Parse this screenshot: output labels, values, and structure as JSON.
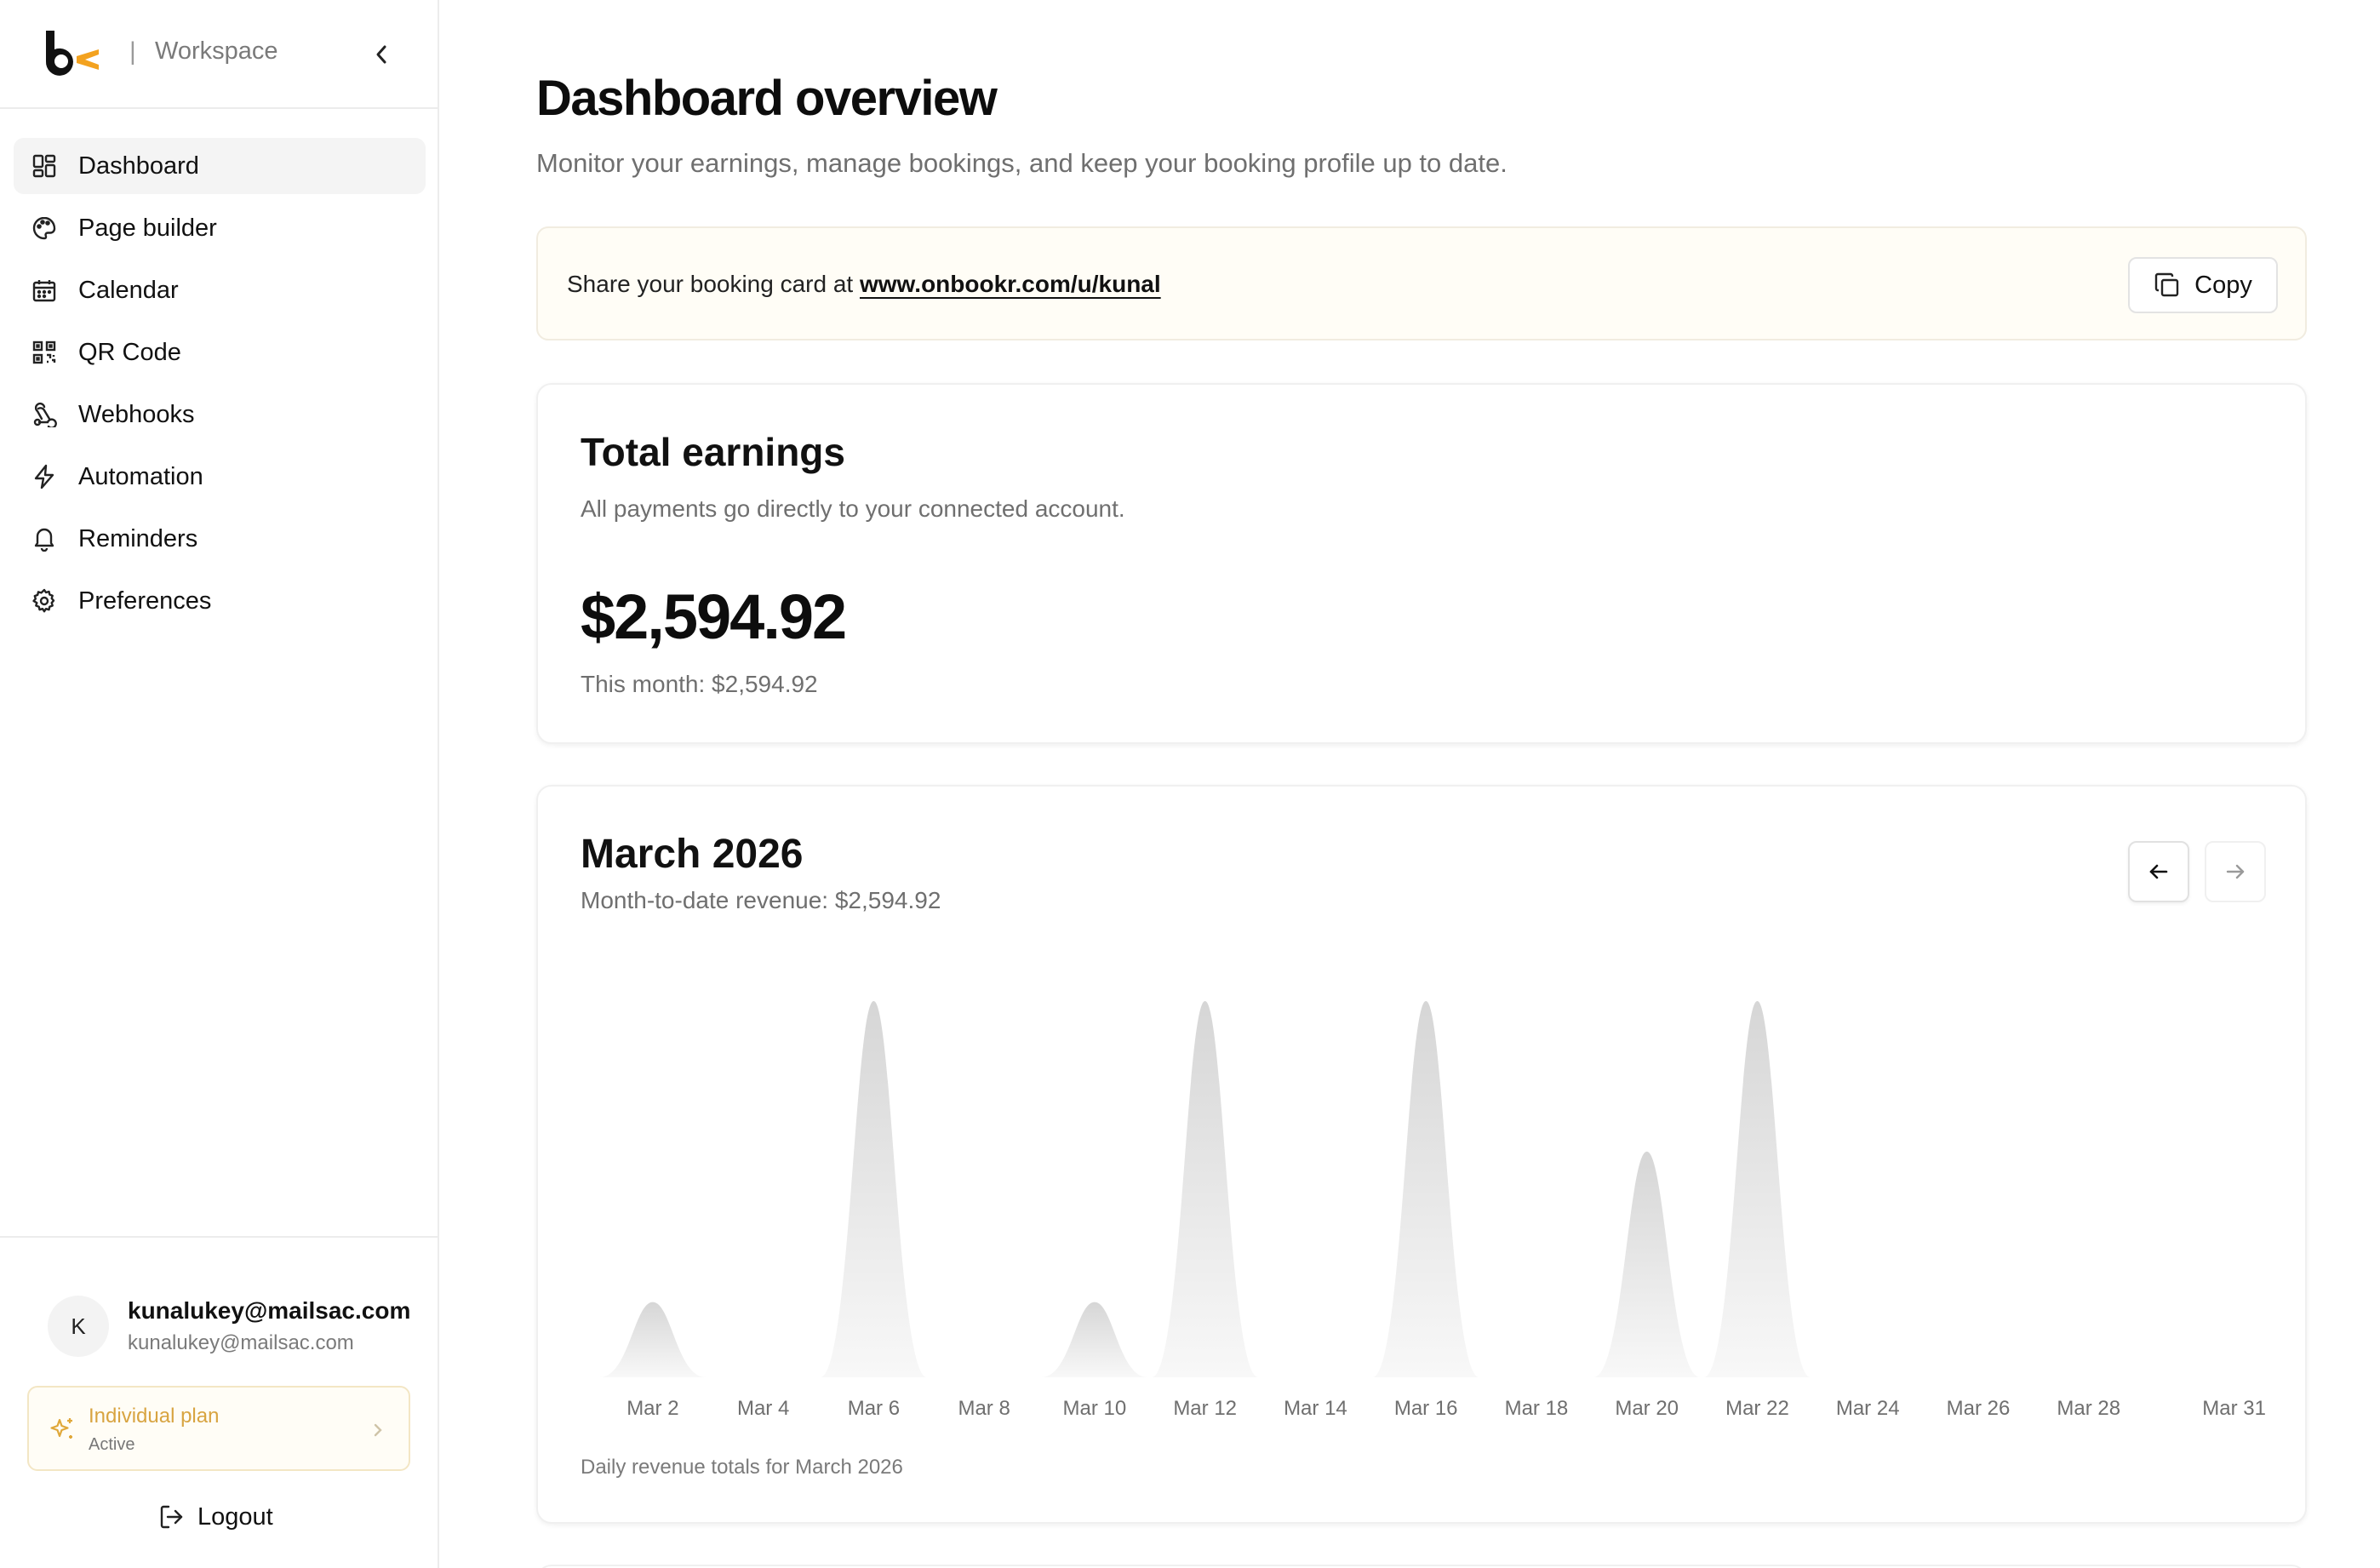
{
  "sidebar": {
    "workspace_sep": "|",
    "workspace_label": "Workspace",
    "items": [
      {
        "label": "Dashboard",
        "icon": "dashboard-grid-icon",
        "active": true
      },
      {
        "label": "Page builder",
        "icon": "palette-icon",
        "active": false
      },
      {
        "label": "Calendar",
        "icon": "calendar-icon",
        "active": false
      },
      {
        "label": "QR Code",
        "icon": "qr-code-icon",
        "active": false
      },
      {
        "label": "Webhooks",
        "icon": "webhook-icon",
        "active": false
      },
      {
        "label": "Automation",
        "icon": "lightning-icon",
        "active": false
      },
      {
        "label": "Reminders",
        "icon": "bell-icon",
        "active": false
      },
      {
        "label": "Preferences",
        "icon": "gear-icon",
        "active": false
      }
    ],
    "user": {
      "initial": "K",
      "name": "kunalukey@mailsac.com",
      "email": "kunalukey@mailsac.com"
    },
    "plan": {
      "name": "Individual plan",
      "status": "Active"
    },
    "logout_label": "Logout"
  },
  "main": {
    "title": "Dashboard overview",
    "subtitle": "Monitor your earnings, manage bookings, and keep your booking profile up to date.",
    "share": {
      "prefix": "Share your booking card at ",
      "link": "www.onbookr.com/u/kunal",
      "copy_label": "Copy"
    },
    "earnings": {
      "title": "Total earnings",
      "subtitle": "All payments go directly to your connected account.",
      "total": "$2,594.92",
      "month_line": "This month: $2,594.92"
    },
    "revenue": {
      "title": "March 2026",
      "subtitle": "Month-to-date revenue: $2,594.92",
      "caption": "Daily revenue totals for March 2026"
    }
  },
  "colors": {
    "accent": "#f3a21f",
    "plan_text": "#d8a441",
    "chart_fill_top": "#d6d6d6",
    "chart_fill_bottom": "#f7f7f7"
  },
  "chart_data": {
    "type": "area",
    "x": [
      "Mar 1",
      "Mar 2",
      "Mar 3",
      "Mar 4",
      "Mar 5",
      "Mar 6",
      "Mar 7",
      "Mar 8",
      "Mar 9",
      "Mar 10",
      "Mar 11",
      "Mar 12",
      "Mar 13",
      "Mar 14",
      "Mar 15",
      "Mar 16",
      "Mar 17",
      "Mar 18",
      "Mar 19",
      "Mar 20",
      "Mar 21",
      "Mar 22",
      "Mar 23",
      "Mar 24",
      "Mar 25",
      "Mar 26",
      "Mar 27",
      "Mar 28",
      "Mar 29",
      "Mar 30",
      "Mar 31"
    ],
    "values": [
      0,
      88,
      0,
      0,
      0,
      440,
      0,
      0,
      0,
      88,
      0,
      440,
      0,
      0,
      0,
      440,
      0,
      0,
      0,
      264,
      0,
      440,
      0,
      0,
      0,
      0,
      0,
      0,
      0,
      0,
      0
    ],
    "tick_labels": [
      "Mar 2",
      "Mar 4",
      "Mar 6",
      "Mar 8",
      "Mar 10",
      "Mar 12",
      "Mar 14",
      "Mar 16",
      "Mar 18",
      "Mar 20",
      "Mar 22",
      "Mar 24",
      "Mar 26",
      "Mar 28",
      "Mar 31"
    ],
    "grid": false,
    "legend": "none"
  }
}
